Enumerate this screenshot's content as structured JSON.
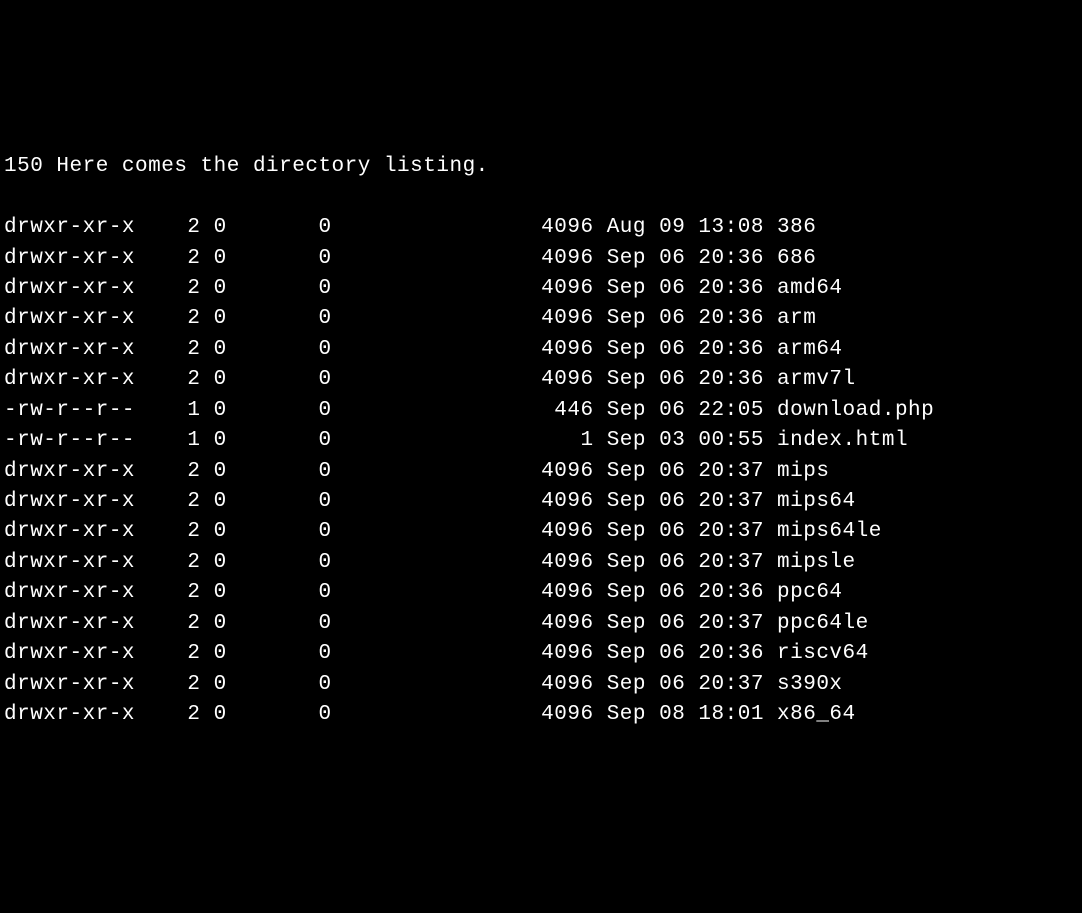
{
  "header": "150 Here comes the directory listing.",
  "listing": [
    {
      "perms": "drwxr-xr-x",
      "links": "2",
      "owner": "0",
      "group": "0",
      "size": "4096",
      "month": "Aug",
      "day": "09",
      "time": "13:08",
      "name": "386"
    },
    {
      "perms": "drwxr-xr-x",
      "links": "2",
      "owner": "0",
      "group": "0",
      "size": "4096",
      "month": "Sep",
      "day": "06",
      "time": "20:36",
      "name": "686"
    },
    {
      "perms": "drwxr-xr-x",
      "links": "2",
      "owner": "0",
      "group": "0",
      "size": "4096",
      "month": "Sep",
      "day": "06",
      "time": "20:36",
      "name": "amd64"
    },
    {
      "perms": "drwxr-xr-x",
      "links": "2",
      "owner": "0",
      "group": "0",
      "size": "4096",
      "month": "Sep",
      "day": "06",
      "time": "20:36",
      "name": "arm"
    },
    {
      "perms": "drwxr-xr-x",
      "links": "2",
      "owner": "0",
      "group": "0",
      "size": "4096",
      "month": "Sep",
      "day": "06",
      "time": "20:36",
      "name": "arm64"
    },
    {
      "perms": "drwxr-xr-x",
      "links": "2",
      "owner": "0",
      "group": "0",
      "size": "4096",
      "month": "Sep",
      "day": "06",
      "time": "20:36",
      "name": "armv7l"
    },
    {
      "perms": "-rw-r--r--",
      "links": "1",
      "owner": "0",
      "group": "0",
      "size": "446",
      "month": "Sep",
      "day": "06",
      "time": "22:05",
      "name": "download.php"
    },
    {
      "perms": "-rw-r--r--",
      "links": "1",
      "owner": "0",
      "group": "0",
      "size": "1",
      "month": "Sep",
      "day": "03",
      "time": "00:55",
      "name": "index.html"
    },
    {
      "perms": "drwxr-xr-x",
      "links": "2",
      "owner": "0",
      "group": "0",
      "size": "4096",
      "month": "Sep",
      "day": "06",
      "time": "20:37",
      "name": "mips"
    },
    {
      "perms": "drwxr-xr-x",
      "links": "2",
      "owner": "0",
      "group": "0",
      "size": "4096",
      "month": "Sep",
      "day": "06",
      "time": "20:37",
      "name": "mips64"
    },
    {
      "perms": "drwxr-xr-x",
      "links": "2",
      "owner": "0",
      "group": "0",
      "size": "4096",
      "month": "Sep",
      "day": "06",
      "time": "20:37",
      "name": "mips64le"
    },
    {
      "perms": "drwxr-xr-x",
      "links": "2",
      "owner": "0",
      "group": "0",
      "size": "4096",
      "month": "Sep",
      "day": "06",
      "time": "20:37",
      "name": "mipsle"
    },
    {
      "perms": "drwxr-xr-x",
      "links": "2",
      "owner": "0",
      "group": "0",
      "size": "4096",
      "month": "Sep",
      "day": "06",
      "time": "20:36",
      "name": "ppc64"
    },
    {
      "perms": "drwxr-xr-x",
      "links": "2",
      "owner": "0",
      "group": "0",
      "size": "4096",
      "month": "Sep",
      "day": "06",
      "time": "20:37",
      "name": "ppc64le"
    },
    {
      "perms": "drwxr-xr-x",
      "links": "2",
      "owner": "0",
      "group": "0",
      "size": "4096",
      "month": "Sep",
      "day": "06",
      "time": "20:36",
      "name": "riscv64"
    },
    {
      "perms": "drwxr-xr-x",
      "links": "2",
      "owner": "0",
      "group": "0",
      "size": "4096",
      "month": "Sep",
      "day": "06",
      "time": "20:37",
      "name": "s390x"
    },
    {
      "perms": "drwxr-xr-x",
      "links": "2",
      "owner": "0",
      "group": "0",
      "size": "4096",
      "month": "Sep",
      "day": "08",
      "time": "18:01",
      "name": "x86_64"
    }
  ]
}
